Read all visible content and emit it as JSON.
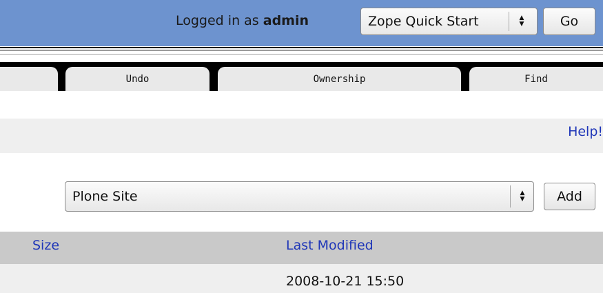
{
  "header": {
    "login_prefix": "Logged in as",
    "username": "admin",
    "quick_start_selected": "Zope Quick Start",
    "go_label": "Go"
  },
  "tabs": [
    {
      "label": ""
    },
    {
      "label": "Undo"
    },
    {
      "label": "Ownership"
    },
    {
      "label": "Find"
    }
  ],
  "help": {
    "label": "Help!"
  },
  "add_bar": {
    "type_selected": "Plone Site",
    "add_label": "Add"
  },
  "table": {
    "columns": [
      "Size",
      "Last Modified"
    ],
    "rows": [
      {
        "size": "",
        "last_modified": "2008-10-21 15:50"
      }
    ]
  },
  "colors": {
    "header_bg": "#6d93cf",
    "link": "#1f36b8",
    "table_header_bg": "#c9c9c9",
    "row_bg": "#efefef"
  }
}
